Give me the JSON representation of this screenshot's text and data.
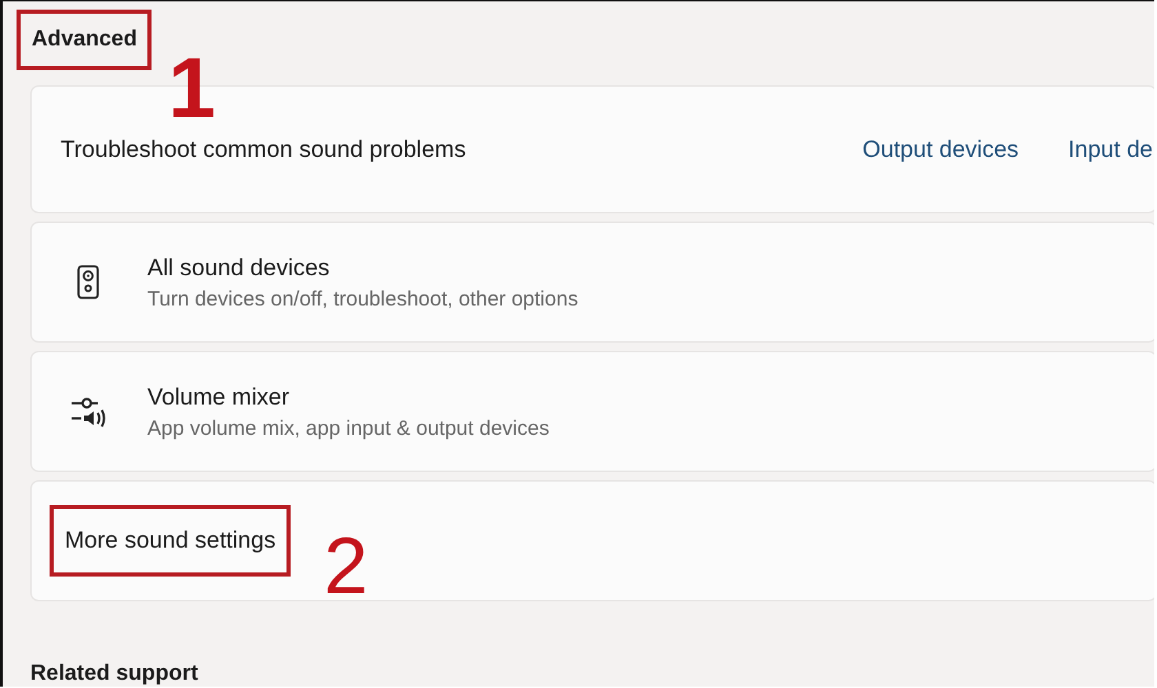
{
  "section": {
    "title": "Advanced",
    "marker": "1"
  },
  "troubleshoot": {
    "label": "Troubleshoot common sound problems",
    "links": [
      "Output devices",
      "Input de"
    ]
  },
  "items": [
    {
      "kind": "speaker",
      "title": "All sound devices",
      "subtitle": "Turn devices on/off, troubleshoot, other options"
    },
    {
      "kind": "mixer",
      "title": "Volume mixer",
      "subtitle": "App volume mix, app input & output devices"
    },
    {
      "kind": "plain",
      "title": "More sound settings",
      "marker": "2"
    }
  ],
  "related": {
    "title": "Related support"
  }
}
